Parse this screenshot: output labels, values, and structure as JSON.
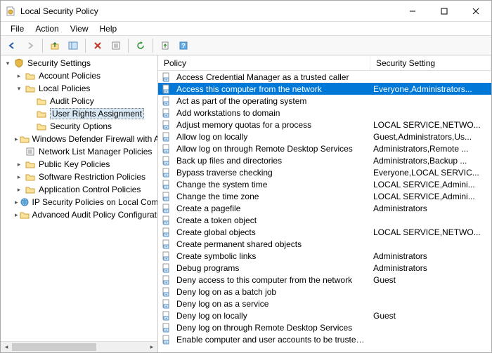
{
  "window": {
    "title": "Local Security Policy"
  },
  "menu": {
    "file": "File",
    "action": "Action",
    "view": "View",
    "help": "Help"
  },
  "tree": {
    "root": "Security Settings",
    "items": [
      {
        "label": "Account Policies"
      },
      {
        "label": "Local Policies",
        "expanded": true,
        "children": [
          {
            "label": "Audit Policy"
          },
          {
            "label": "User Rights Assignment",
            "selected": true
          },
          {
            "label": "Security Options"
          }
        ]
      },
      {
        "label": "Windows Defender Firewall with Adva"
      },
      {
        "label": "Network List Manager Policies"
      },
      {
        "label": "Public Key Policies"
      },
      {
        "label": "Software Restriction Policies"
      },
      {
        "label": "Application Control Policies"
      },
      {
        "label": "IP Security Policies on Local Compute"
      },
      {
        "label": "Advanced Audit Policy Configuration"
      }
    ]
  },
  "list": {
    "header": {
      "policy": "Policy",
      "setting": "Security Setting"
    },
    "rows": [
      {
        "policy": "Access Credential Manager as a trusted caller",
        "setting": ""
      },
      {
        "policy": "Access this computer from the network",
        "setting": "Everyone,Administrators...",
        "selected": true
      },
      {
        "policy": "Act as part of the operating system",
        "setting": ""
      },
      {
        "policy": "Add workstations to domain",
        "setting": ""
      },
      {
        "policy": "Adjust memory quotas for a process",
        "setting": "LOCAL SERVICE,NETWO..."
      },
      {
        "policy": "Allow log on locally",
        "setting": "Guest,Administrators,Us..."
      },
      {
        "policy": "Allow log on through Remote Desktop Services",
        "setting": "Administrators,Remote ..."
      },
      {
        "policy": "Back up files and directories",
        "setting": "Administrators,Backup ..."
      },
      {
        "policy": "Bypass traverse checking",
        "setting": "Everyone,LOCAL SERVIC..."
      },
      {
        "policy": "Change the system time",
        "setting": "LOCAL SERVICE,Admini..."
      },
      {
        "policy": "Change the time zone",
        "setting": "LOCAL SERVICE,Admini..."
      },
      {
        "policy": "Create a pagefile",
        "setting": "Administrators"
      },
      {
        "policy": "Create a token object",
        "setting": ""
      },
      {
        "policy": "Create global objects",
        "setting": "LOCAL SERVICE,NETWO..."
      },
      {
        "policy": "Create permanent shared objects",
        "setting": ""
      },
      {
        "policy": "Create symbolic links",
        "setting": "Administrators"
      },
      {
        "policy": "Debug programs",
        "setting": "Administrators"
      },
      {
        "policy": "Deny access to this computer from the network",
        "setting": "Guest"
      },
      {
        "policy": "Deny log on as a batch job",
        "setting": ""
      },
      {
        "policy": "Deny log on as a service",
        "setting": ""
      },
      {
        "policy": "Deny log on locally",
        "setting": "Guest"
      },
      {
        "policy": "Deny log on through Remote Desktop Services",
        "setting": ""
      },
      {
        "policy": "Enable computer and user accounts to be trusted for delega",
        "setting": ""
      }
    ]
  }
}
